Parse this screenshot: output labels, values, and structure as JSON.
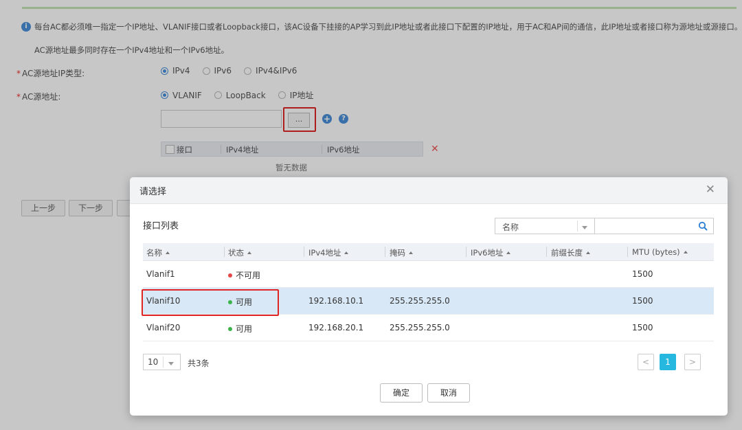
{
  "background": {
    "info_text_1": "每台AC都必须唯一指定一个IP地址、VLANIF接口或者Loopback接口，该AC设备下挂接的AP学习到此IP地址或者此接口下配置的IP地址，用于AC和AP间的通信，此IP地址或者接口称为源地址或源接口。",
    "info_text_2": "AC源地址最多同时存在一个IPv4地址和一个IPv6地址。",
    "ip_type_label": "AC源地址IP类型:",
    "ip_type_options": [
      "IPv4",
      "IPv6",
      "IPv4&IPv6"
    ],
    "source_label": "AC源地址:",
    "source_options": [
      "VLANIF",
      "LoopBack",
      "IP地址"
    ],
    "browse_label": "...",
    "mini_table_headers": [
      "接口",
      "IPv4地址",
      "IPv6地址"
    ],
    "empty_text": "暂无数据",
    "prev_step": "上一步",
    "next_step": "下一步"
  },
  "dialog": {
    "title": "请选择",
    "section_title": "接口列表",
    "search_field": "名称",
    "search_placeholder": "",
    "columns": [
      "名称",
      "状态",
      "IPv4地址",
      "掩码",
      "IPv6地址",
      "前缀长度",
      "MTU (bytes)"
    ],
    "rows": [
      {
        "name": "Vlanif1",
        "status": "不可用",
        "status_color": "#e64545",
        "ipv4": "",
        "mask": "",
        "ipv6": "",
        "prefix": "",
        "mtu": "1500"
      },
      {
        "name": "Vlanif10",
        "status": "可用",
        "status_color": "#3cb44b",
        "ipv4": "192.168.10.1",
        "mask": "255.255.255.0",
        "ipv6": "",
        "prefix": "",
        "mtu": "1500"
      },
      {
        "name": "Vlanif20",
        "status": "可用",
        "status_color": "#3cb44b",
        "ipv4": "192.168.20.1",
        "mask": "255.255.255.0",
        "ipv6": "",
        "prefix": "",
        "mtu": "1500"
      }
    ],
    "selected_row": 1,
    "page_size": "10",
    "total_text": "共3条",
    "current_page": "1",
    "ok_label": "确定",
    "cancel_label": "取消"
  },
  "colors": {
    "accent": "#27b8e0",
    "highlight_box": "#e02424",
    "selected_row": "#d9e8f6"
  }
}
